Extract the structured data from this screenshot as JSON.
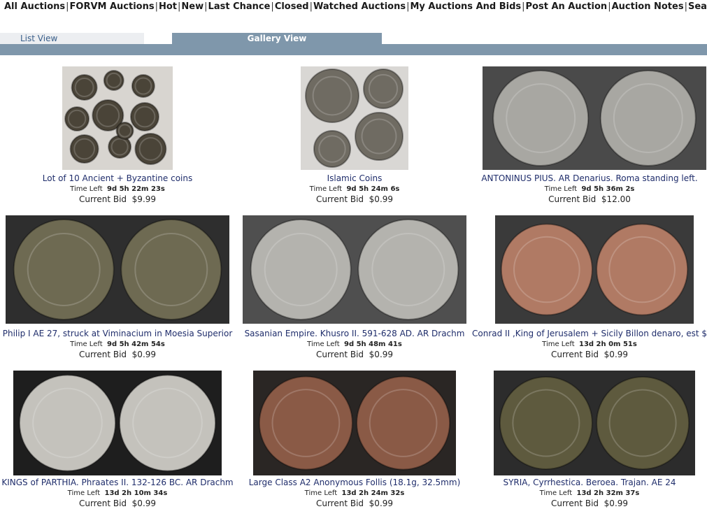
{
  "nav": {
    "items": [
      "All Auctions",
      "FORVM Auctions",
      "Hot",
      "New",
      "Last Chance",
      "Closed",
      "Watched Auctions",
      "My Auctions And Bids",
      "Post An Auction",
      "Auction Notes",
      "Search Auctions"
    ],
    "separator": "|"
  },
  "tabs": {
    "list_view": "List View",
    "gallery_view": "Gallery View"
  },
  "labels": {
    "time_left": "Time Left",
    "current_bid": "Current Bid"
  },
  "auctions": [
    {
      "title": "Lot of 10 Ancient + Byzantine coins",
      "time": "9d 5h 22m 23s",
      "bid": "$9.99",
      "colors": {
        "bg": "#d8d5d0",
        "coin": "#4a4438"
      }
    },
    {
      "title": "Islamic Coins",
      "time": "9d 5h 24m 6s",
      "bid": "$0.99",
      "colors": {
        "bg": "#d9d7d4",
        "coin": "#6f6b62"
      }
    },
    {
      "title": "ANTONINUS PIUS. AR Denarius. Roma standing left.",
      "time": "9d 5h 36m 2s",
      "bid": "$12.00",
      "colors": {
        "bg": "#4a4a4a",
        "coin": "#a8a7a2"
      }
    },
    {
      "title": "Philip I AE 27, struck at Viminacium in Moesia Superior",
      "time": "9d 5h 42m 54s",
      "bid": "$0.99",
      "colors": {
        "bg": "#2e2e2e",
        "coin": "#6e6a52"
      }
    },
    {
      "title": "Sasanian Empire. Khusro II. 591-628 AD. AR Drachm",
      "time": "9d 5h 48m 41s",
      "bid": "$0.99",
      "colors": {
        "bg": "#4f4f4f",
        "coin": "#b4b3ae"
      }
    },
    {
      "title": "Conrad II ,King of Jerusalem + Sicily Billon denaro, est $",
      "time": "13d 2h 0m 51s",
      "bid": "$0.99",
      "colors": {
        "bg": "#3a3a3a",
        "coin": "#b07a64"
      }
    },
    {
      "title": "KINGS of PARTHIA. Phraates II. 132-126 BC. AR Drachm",
      "time": "13d 2h 10m 34s",
      "bid": "$0.99",
      "colors": {
        "bg": "#1e1e1e",
        "coin": "#c4c2bc"
      }
    },
    {
      "title": "Large Class A2 Anonymous Follis (18.1g, 32.5mm)",
      "time": "13d 2h 24m 32s",
      "bid": "$0.99",
      "colors": {
        "bg": "#2a2624",
        "coin": "#8a5a46"
      }
    },
    {
      "title": "SYRIA, Cyrrhestica. Beroea. Trajan. AE 24",
      "time": "13d 2h 32m 37s",
      "bid": "$0.99",
      "colors": {
        "bg": "#2c2c2c",
        "coin": "#5e5a3e"
      }
    }
  ]
}
